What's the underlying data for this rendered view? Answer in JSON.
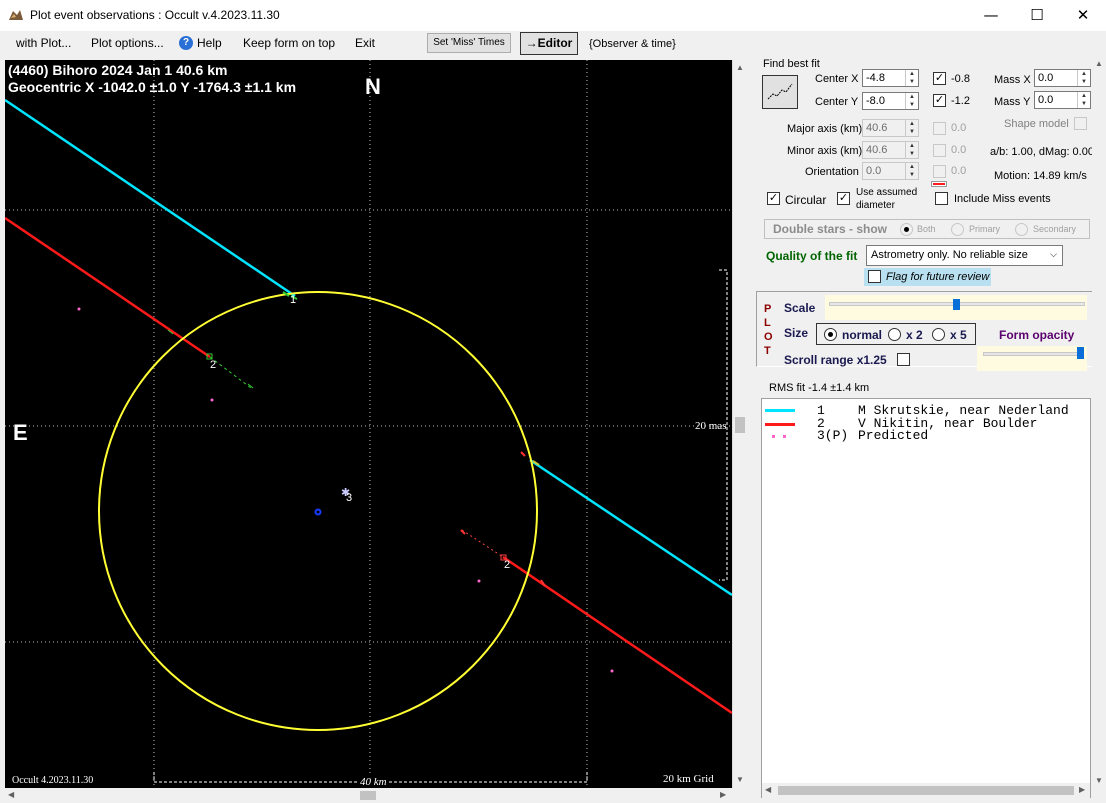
{
  "window": {
    "title": "Plot event observations : Occult v.4.2023.11.30",
    "minimize_glyph": "—",
    "maximize_glyph": "☐",
    "close_glyph": "✕"
  },
  "menu": {
    "items": [
      "with Plot...",
      "Plot options...",
      "Help",
      "Keep form on top",
      "Exit"
    ],
    "help_icon": "?",
    "set_miss_times": "Set 'Miss' Times",
    "editor": "→Editor",
    "observer_time": "{Observer & time}"
  },
  "plot": {
    "header_line1": "(4460) Bihoro  2024 Jan 1   40.6 km",
    "header_line2": "Geocentric  X  -1042.0 ±1.0  Y -1764.3 ±1.1 km",
    "north": "N",
    "east": "E",
    "mas_label": "20 mas",
    "km_label": "40 km",
    "grid_label": "20 km Grid",
    "version_label": "Occult 4.2023.11.30",
    "chord_labels": [
      "1",
      "2",
      "2",
      "3"
    ],
    "colors": {
      "chord1": "#00e5ff",
      "chord2": "#ff1a1a",
      "ellipse": "#ffff33",
      "predicted": "#ff66cc",
      "center": "#1a3cff"
    }
  },
  "fit": {
    "find_best_fit": "Find best fit",
    "center_x_label": "Center X",
    "center_x": "-4.8",
    "center_y_label": "Center Y",
    "center_y": "-8.0",
    "cx_check_label": "-0.8",
    "cy_check_label": "-1.2",
    "mass_x_label": "Mass X",
    "mass_x": "0.0",
    "mass_y_label": "Mass Y",
    "mass_y": "0.0",
    "major_label": "Major axis (km)",
    "major": "40.6",
    "minor_label": "Minor axis (km)",
    "minor": "40.6",
    "orient_label": "Orientation",
    "orient": "0.0",
    "major_chk": "0.0",
    "minor_chk": "0.0",
    "orient_chk": "0.0",
    "shape_model": "Shape model",
    "ab_dmag": "a/b: 1.00, dMag: 0.00",
    "motion": "Motion: 14.89 km/s",
    "circular": "Circular",
    "use_assumed": "Use assumed",
    "diameter": "diameter",
    "include_miss": "Include Miss events",
    "double_stars": "Double stars - show",
    "both": "Both",
    "primary": "Primary",
    "secondary": "Secondary",
    "quality_label": "Quality of the fit",
    "quality_value": "Astrometry only. No reliable size",
    "flag_review": "Flag for future review"
  },
  "plot_panel": {
    "plot_letters": [
      "P",
      "L",
      "O",
      "T"
    ],
    "scale": "Scale",
    "size": "Size",
    "normal": "normal",
    "x2": "x 2",
    "x5": "x 5",
    "form_opacity": "Form opacity",
    "scroll_range": "Scroll range x1.25"
  },
  "results": {
    "rms": "RMS fit -1.4 ±1.4 km",
    "legend": [
      {
        "num": "1",
        "text": "M Skrutskie, near Nederland",
        "color": "#00e5ff"
      },
      {
        "num": "2",
        "text": "V Nikitin, near Boulder",
        "color": "#ff1a1a"
      },
      {
        "num": "3(P)",
        "text": "Predicted",
        "color": "#ff66cc"
      }
    ]
  }
}
